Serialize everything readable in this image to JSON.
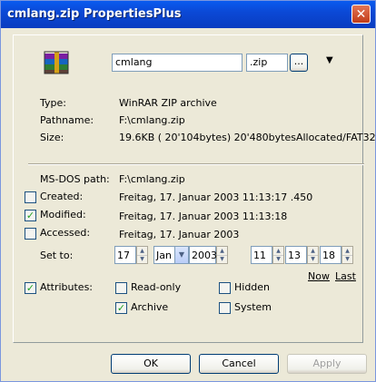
{
  "window": {
    "title": "cmlang.zip PropertiesPlus"
  },
  "file": {
    "name": "cmlang",
    "extension": ".zip",
    "browse_label": "...",
    "icon": "winrar-archive-icon"
  },
  "info": {
    "type_label": "Type:",
    "type_value": "WinRAR ZIP archive",
    "path_label": "Pathname:",
    "path_value": "F:\\cmlang.zip",
    "size_label": "Size:",
    "size_value": "19.6KB ( 20'104bytes) 20'480bytesAllocated/FAT32"
  },
  "times": {
    "msdos_label": "MS-DOS path:",
    "msdos_value": "F:\\cmlang.zip",
    "created_label": "Created:",
    "created_value": "Freitag, 17. Januar 2003 11:13:17 .450",
    "created_checked": false,
    "modified_label": "Modified:",
    "modified_value": "Freitag, 17. Januar 2003 11:13:18",
    "modified_checked": true,
    "accessed_label": "Accessed:",
    "accessed_value": "Freitag, 17. Januar 2003",
    "accessed_checked": false,
    "setto_label": "Set to:",
    "day": "17",
    "month": "Jan",
    "year": "2003",
    "hour": "11",
    "minute": "13",
    "second": "18",
    "now_label": "Now",
    "last_label": "Last"
  },
  "attributes": {
    "label": "Attributes:",
    "checked": true,
    "readonly_label": "Read-only",
    "readonly_checked": false,
    "archive_label": "Archive",
    "archive_checked": true,
    "hidden_label": "Hidden",
    "hidden_checked": false,
    "system_label": "System",
    "system_checked": false
  },
  "buttons": {
    "ok": "OK",
    "cancel": "Cancel",
    "apply": "Apply"
  }
}
